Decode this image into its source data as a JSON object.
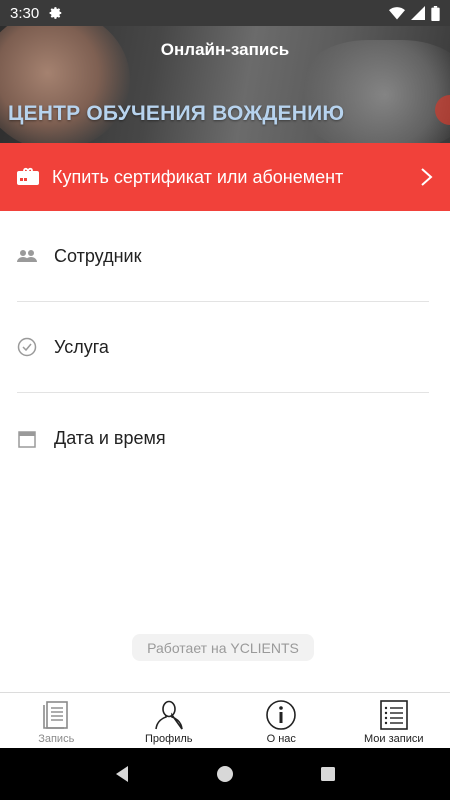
{
  "status_bar": {
    "time": "3:30"
  },
  "header": {
    "title": "Онлайн-запись",
    "subtitle": "ЦЕНТР ОБУЧЕНИЯ ВОЖДЕНИЮ"
  },
  "cta": {
    "label": "Купить сертификат или абонемент"
  },
  "rows": [
    {
      "label": "Сотрудник"
    },
    {
      "label": "Услуга"
    },
    {
      "label": "Дата и время"
    }
  ],
  "powered_by": "Работает на YCLIENTS",
  "tabs": [
    {
      "label": "Запись"
    },
    {
      "label": "Профиль"
    },
    {
      "label": "О нас"
    },
    {
      "label": "Мои записи"
    }
  ],
  "colors": {
    "accent": "#f1413a",
    "subtitle": "#b7d3ee",
    "status_bar": "#3a3a3a"
  },
  "icons": {
    "cta": "ticket-icon",
    "rows": [
      "people-icon",
      "check-circle-icon",
      "calendar-icon"
    ],
    "tabs": [
      "document-icon",
      "person-icon",
      "info-icon",
      "list-icon"
    ]
  }
}
